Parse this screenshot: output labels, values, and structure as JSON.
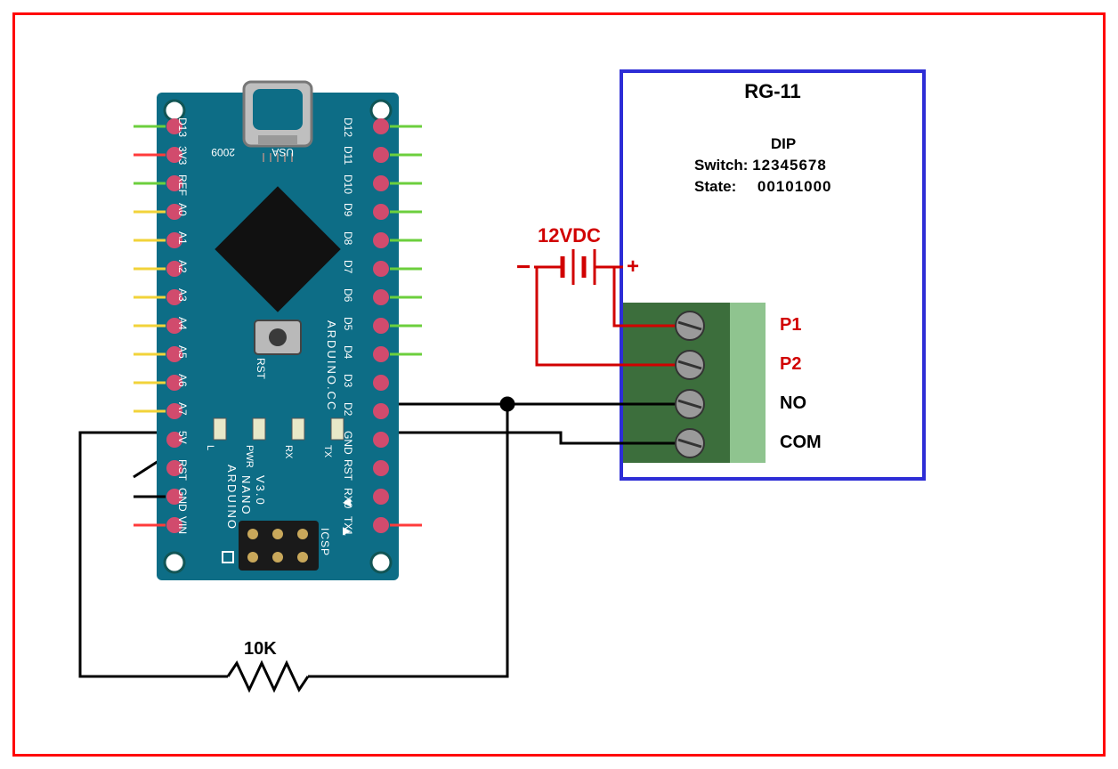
{
  "module": {
    "title": "RG-11",
    "dip_header": "DIP",
    "dip_switch_label": "Switch:",
    "dip_switch_value": "12345678",
    "dip_state_label": "State:",
    "dip_state_value": "00101000",
    "terminals": [
      "P1",
      "P2",
      "NO",
      "COM"
    ]
  },
  "power": {
    "label": "12VDC",
    "plus": "+",
    "minus": "−"
  },
  "resistor": {
    "label": "10K"
  },
  "arduino": {
    "brand_top": "USA",
    "brand_top2": "2009",
    "name_line1": "ARDUINO.CC",
    "name_line2": "ARDUINO",
    "name_line3": "NANO",
    "name_line4": "V3.0",
    "rst_button": "RST",
    "icsp": "ICSP",
    "leds": [
      "L",
      "PWR",
      "RX",
      "TX"
    ],
    "left_pins": [
      "D13",
      "3V3",
      "REF",
      "A0",
      "A1",
      "A2",
      "A3",
      "A4",
      "A5",
      "A6",
      "A7",
      "5V",
      "RST",
      "GND",
      "VIN"
    ],
    "right_pins": [
      "D12",
      "D11",
      "D10",
      "D9",
      "D8",
      "D7",
      "D6",
      "D5",
      "D4",
      "D3",
      "D2",
      "GND",
      "RST",
      "RX0",
      "TX1"
    ],
    "rx_arrow": "◀",
    "tx_arrow": "▶"
  }
}
